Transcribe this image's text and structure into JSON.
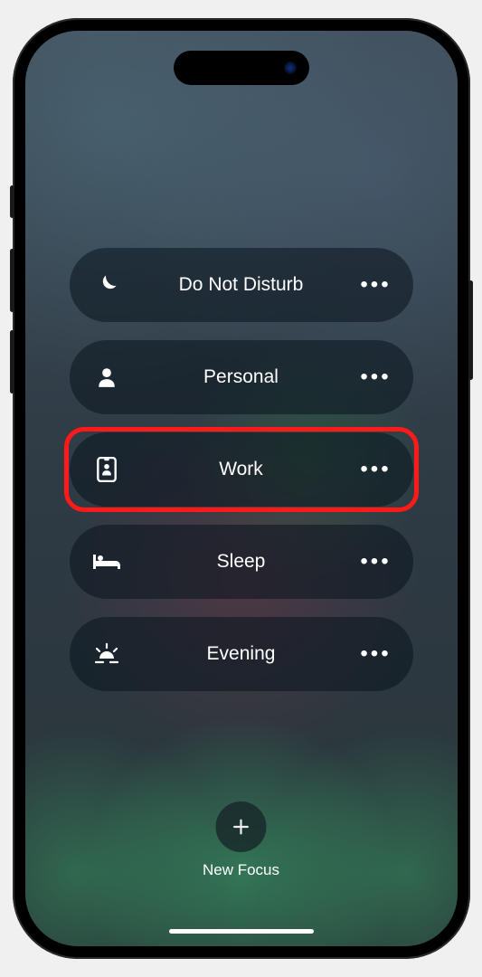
{
  "focus_modes": [
    {
      "id": "do-not-disturb",
      "icon": "moon-icon",
      "label": "Do Not Disturb",
      "highlighted": false
    },
    {
      "id": "personal",
      "icon": "person-icon",
      "label": "Personal",
      "highlighted": false
    },
    {
      "id": "work",
      "icon": "badge-icon",
      "label": "Work",
      "highlighted": true
    },
    {
      "id": "sleep",
      "icon": "bed-icon",
      "label": "Sleep",
      "highlighted": false
    },
    {
      "id": "evening",
      "icon": "sunset-icon",
      "label": "Evening",
      "highlighted": false
    }
  ],
  "new_focus": {
    "label": "New Focus"
  },
  "ellipsis": "•••"
}
